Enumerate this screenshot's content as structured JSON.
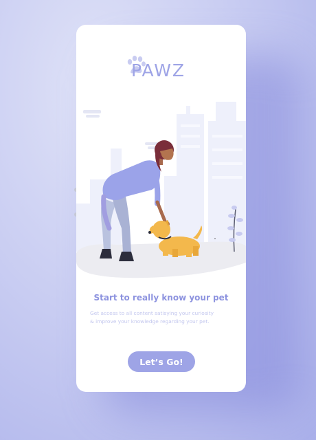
{
  "app": {
    "logo_text": "PAWZ",
    "logo_icon": "paw-icon"
  },
  "onboarding": {
    "headline": "Start to really know your pet",
    "description_lines": [
      "Get access to all content satisying your curiosity",
      "& improve your knowledge regarding your pet."
    ],
    "cta_label": "Let’s Go!",
    "illustration": "woman-petting-dog-illustration"
  },
  "colors": {
    "accent": "#9ea4e6",
    "headline": "#8d93df",
    "subtext": "#c3c7ee",
    "background": "#c9cdf2",
    "card": "#ffffff",
    "dog": "#f3b84c"
  }
}
